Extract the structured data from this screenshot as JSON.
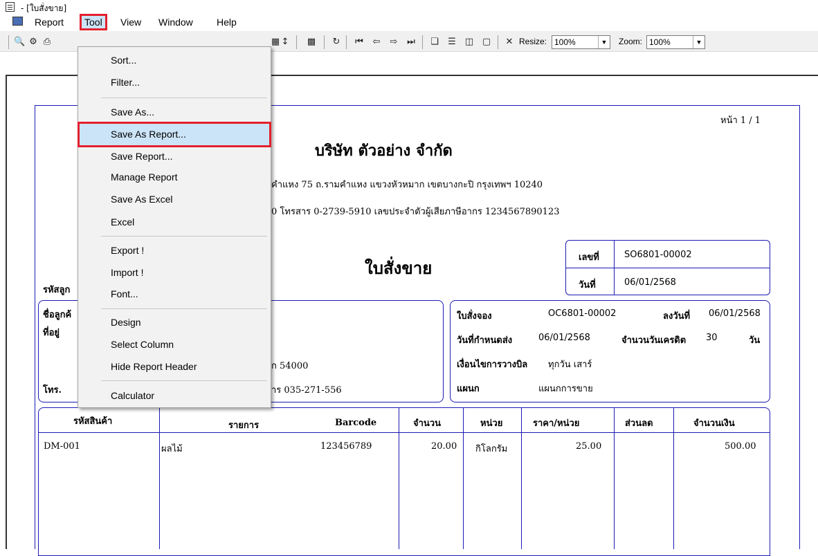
{
  "window": {
    "title": "- [ใบสั่งขาย]"
  },
  "menubar": {
    "items": [
      "Report",
      "Tool",
      "View",
      "Window",
      "Help"
    ]
  },
  "toolbar": {
    "resize_label": "Resize:",
    "resize_value": "100%",
    "zoom_label": "Zoom:",
    "zoom_value": "100%"
  },
  "tool_menu": {
    "items": [
      "Sort...",
      "Filter...",
      "Save As...",
      "Save As Report...",
      "Save Report...",
      "Manage Report",
      "Save As Excel",
      "Excel",
      "Export !",
      "Import !",
      "Font...",
      "Design",
      "Select Column",
      "Hide Report Header",
      "Calculator"
    ],
    "highlighted": "Save As Report..."
  },
  "report": {
    "page": "หน้า 1 / 1",
    "company": "บริษัท ตัวอย่าง จำกัด",
    "address_tail": "คำแหง 75 ถ.รามคำแหง แขวงหัวหมาก เขตบางกะปิ กรุงเทพฯ 10240",
    "contact_tail": "0  โทรสาร 0-2739-5910  เลขประจำตัวผู้เสียภาษีอากร 1234567890123",
    "doc_title": "ใบสั่งขาย",
    "doc_no_label": "เลขที่",
    "doc_no": "SO6801-00002",
    "date_label": "วันที่",
    "date": "06/01/2568",
    "customer_code_label": "รหัสลูก",
    "customer_name_label": "ชื่อลูกค้",
    "address_label": "ที่อยู่",
    "postcode_tail": "ก 54000",
    "phone_label": "โทร.",
    "fax_tail": "าร  035-271-556",
    "booking_label": "ใบสั่งจอง",
    "booking_no": "OC6801-00002",
    "booking_date_label": "ลงวันที่",
    "booking_date": "06/01/2568",
    "due_label": "วันที่กำหนดส่ง",
    "due_date": "06/01/2568",
    "credit_label": "จำนวนวันเครดิต",
    "credit_days": "30",
    "credit_unit": "วัน",
    "billing_label": "เงื่อนไขการวางบิล",
    "billing_value": "ทุกวัน เสาร์",
    "dept_label": "แผนก",
    "dept_value": "แผนกการขาย"
  },
  "table": {
    "headers": [
      "รหัสสินค้า",
      "รายการ",
      "Barcode",
      "จำนวน",
      "หน่วย",
      "ราคา/หน่วย",
      "ส่วนลด",
      "จำนวนเงิน"
    ],
    "rows": [
      [
        "DM-001",
        "ผลไม้",
        "123456789",
        "20.00",
        "กิโลกรัม",
        "25.00",
        "",
        "500.00"
      ]
    ]
  },
  "colors": {
    "frame": "#1a1ab4",
    "highlight": "#e3202d",
    "menu_hover": "#cce4f7"
  }
}
